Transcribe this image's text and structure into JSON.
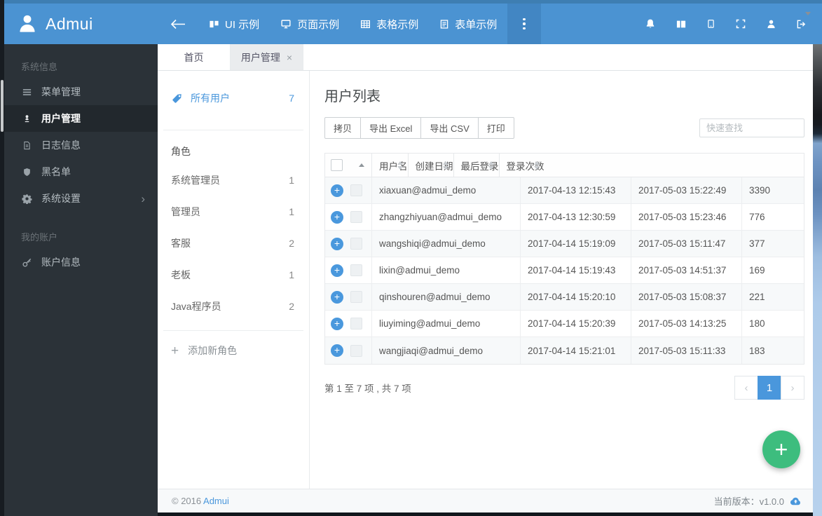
{
  "brand": {
    "name": "Admui"
  },
  "navbar": {
    "items": [
      {
        "icon": "columns",
        "label": "UI 示例"
      },
      {
        "icon": "monitor",
        "label": "页面示例"
      },
      {
        "icon": "table",
        "label": "表格示例"
      },
      {
        "icon": "form",
        "label": "表单示例"
      }
    ],
    "right_icons": [
      "bell",
      "layout",
      "tablet",
      "fullscreen",
      "user",
      "signout"
    ]
  },
  "sidebar": {
    "sections": [
      {
        "label": "系统信息",
        "items": [
          {
            "icon": "menu",
            "label": "菜单管理"
          },
          {
            "icon": "user-manage",
            "label": "用户管理",
            "active": true
          },
          {
            "icon": "file",
            "label": "日志信息"
          },
          {
            "icon": "shield",
            "label": "黑名单"
          },
          {
            "icon": "gear",
            "label": "系统设置",
            "chevron": true
          }
        ]
      },
      {
        "label": "我的账户",
        "items": [
          {
            "icon": "key",
            "label": "账户信息"
          }
        ]
      }
    ]
  },
  "tabs": [
    {
      "label": "首页"
    },
    {
      "label": "用户管理",
      "closable": true,
      "active": true
    }
  ],
  "panel": {
    "all_users_label": "所有用户",
    "all_users_count": "7",
    "roles_label": "角色",
    "roles": [
      {
        "name": "系统管理员",
        "count": "1"
      },
      {
        "name": "管理员",
        "count": "1"
      },
      {
        "name": "客服",
        "count": "2"
      },
      {
        "name": "老板",
        "count": "1"
      },
      {
        "name": "Java程序员",
        "count": "2"
      }
    ],
    "add_role_label": "添加新角色"
  },
  "main": {
    "title": "用户列表",
    "toolbar": {
      "buttons": [
        "拷贝",
        "导出 Excel",
        "导出 CSV",
        "打印"
      ],
      "search_placeholder": "快速查找"
    },
    "table": {
      "columns": [
        "用户名",
        "创建日期",
        "最后登录",
        "登录次数"
      ],
      "rows": [
        {
          "username": "xiaxuan@admui_demo",
          "created": "2017-04-13 12:15:43",
          "last_login": "2017-05-03 15:22:49",
          "logins": "3390"
        },
        {
          "username": "zhangzhiyuan@admui_demo",
          "created": "2017-04-13 12:30:59",
          "last_login": "2017-05-03 15:23:46",
          "logins": "776"
        },
        {
          "username": "wangshiqi@admui_demo",
          "created": "2017-04-14 15:19:09",
          "last_login": "2017-05-03 15:11:47",
          "logins": "377"
        },
        {
          "username": "lixin@admui_demo",
          "created": "2017-04-14 15:19:43",
          "last_login": "2017-05-03 14:51:37",
          "logins": "169"
        },
        {
          "username": "qinshouren@admui_demo",
          "created": "2017-04-14 15:20:10",
          "last_login": "2017-05-03 15:08:37",
          "logins": "221"
        },
        {
          "username": "liuyiming@admui_demo",
          "created": "2017-04-14 15:20:39",
          "last_login": "2017-05-03 14:13:25",
          "logins": "180"
        },
        {
          "username": "wangjiaqi@admui_demo",
          "created": "2017-04-14 15:21:01",
          "last_login": "2017-05-03 15:11:33",
          "logins": "183"
        }
      ]
    },
    "pagination": {
      "info": "第 1 至 7 项 , 共 7 项",
      "prev": "‹",
      "current": "1",
      "next": "›"
    }
  },
  "footer": {
    "copyright": "© 2016",
    "brand": "Admui",
    "version": "当前版本：v1.0.0"
  },
  "glyphs": {
    "plus": "+",
    "close": "×",
    "chevron_right": "›"
  },
  "colors": {
    "accent": "#4a97dc",
    "navbar": "#4b93d2",
    "sidebar": "#2b3238",
    "fab": "#3dbd7e"
  }
}
